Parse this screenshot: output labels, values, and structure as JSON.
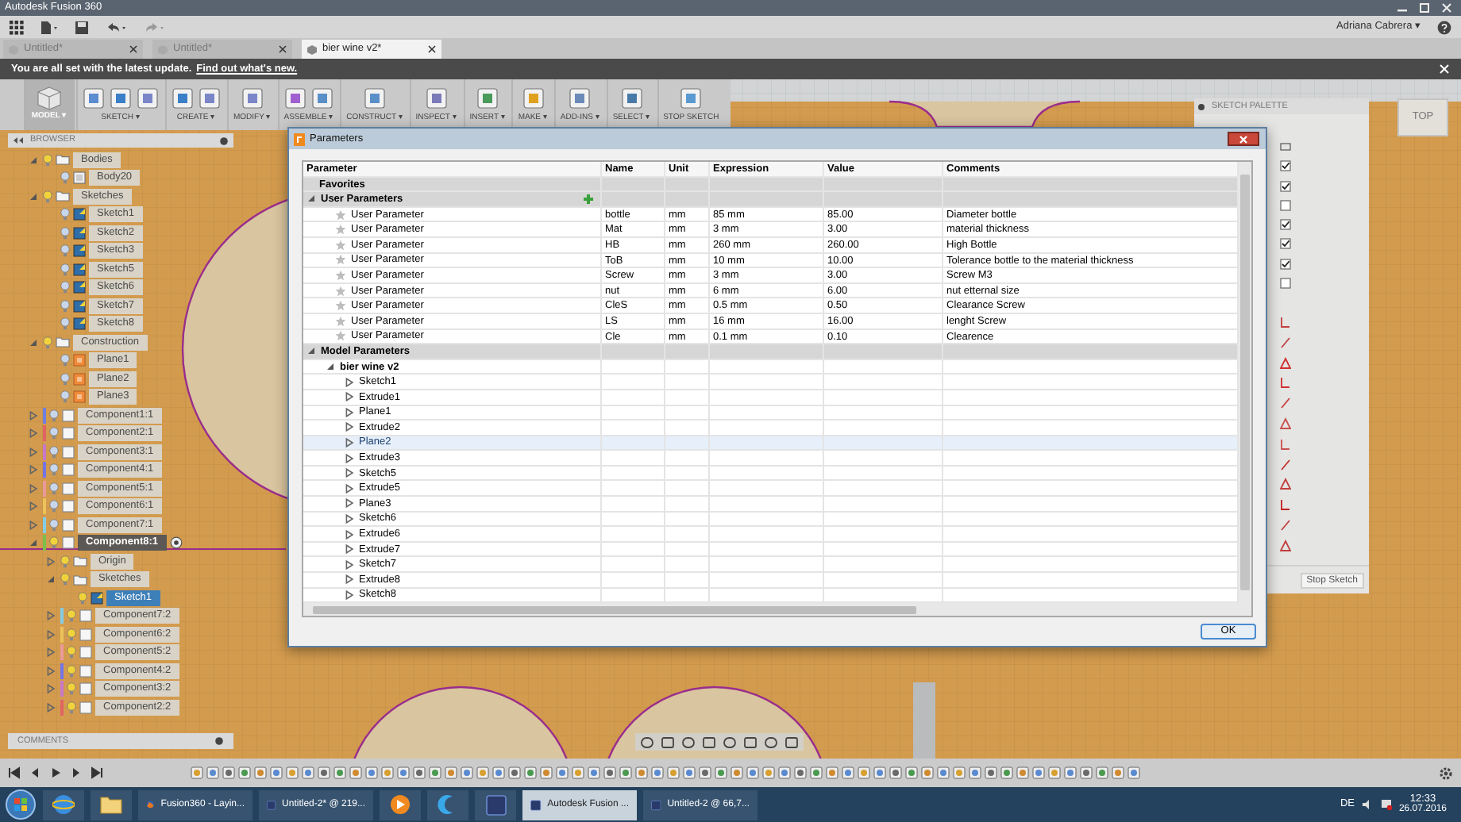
{
  "title_bar": {
    "title": "Autodesk Fusion 360"
  },
  "app_bar": {
    "user": "Adriana Cabrera ▾"
  },
  "tabs": [
    {
      "label": "Untitled*",
      "selected": false
    },
    {
      "label": "Untitled*",
      "selected": false
    },
    {
      "label": "bier wine v2*",
      "selected": true
    }
  ],
  "notice": {
    "text": "You are all set with the latest update.",
    "link": "Find out what's new."
  },
  "toolbar": {
    "workspace": {
      "label": "MODEL ▾"
    },
    "groups": [
      {
        "label": "SKETCH ▾"
      },
      {
        "label": "CREATE ▾"
      },
      {
        "label": "MODIFY ▾"
      },
      {
        "label": "ASSEMBLE ▾"
      },
      {
        "label": "CONSTRUCT ▾"
      },
      {
        "label": "INSPECT ▾"
      },
      {
        "label": "INSERT ▾"
      },
      {
        "label": "MAKE ▾"
      },
      {
        "label": "ADD-INS ▾"
      },
      {
        "label": "SELECT ▾"
      },
      {
        "label": "STOP SKETCH"
      }
    ]
  },
  "browser": {
    "title": "BROWSER",
    "items": [
      {
        "label": "Bodies",
        "kind": "folder",
        "expanded": true,
        "selected": false,
        "children": [
          {
            "label": "Body20",
            "kind": "body",
            "selected": false
          }
        ]
      },
      {
        "label": "Sketches",
        "kind": "folder",
        "expanded": true,
        "selected": false,
        "children": [
          {
            "label": "Sketch1",
            "kind": "sketch",
            "selected": false
          },
          {
            "label": "Sketch2",
            "kind": "sketch",
            "selected": false
          },
          {
            "label": "Sketch3",
            "kind": "sketch",
            "selected": false
          },
          {
            "label": "Sketch5",
            "kind": "sketch",
            "selected": false
          },
          {
            "label": "Sketch6",
            "kind": "sketch",
            "selected": false
          },
          {
            "label": "Sketch7",
            "kind": "sketch",
            "selected": false
          },
          {
            "label": "Sketch8",
            "kind": "sketch",
            "selected": false
          }
        ]
      },
      {
        "label": "Construction",
        "kind": "folder",
        "expanded": true,
        "selected": false,
        "children": [
          {
            "label": "Plane1",
            "kind": "plane",
            "selected": false
          },
          {
            "label": "Plane2",
            "kind": "plane",
            "selected": false
          },
          {
            "label": "Plane3",
            "kind": "plane",
            "selected": false
          }
        ]
      },
      {
        "label": "Component1:1",
        "kind": "component",
        "expanded": false,
        "selected": false,
        "color": "#6f7fe0"
      },
      {
        "label": "Component2:1",
        "kind": "component",
        "expanded": false,
        "selected": false,
        "color": "#e06464"
      },
      {
        "label": "Component3:1",
        "kind": "component",
        "expanded": false,
        "selected": false,
        "color": "#c878c8"
      },
      {
        "label": "Component4:1",
        "kind": "component",
        "expanded": false,
        "selected": false,
        "color": "#7474e4"
      },
      {
        "label": "Component5:1",
        "kind": "component",
        "expanded": false,
        "selected": false,
        "color": "#eb9a9a"
      },
      {
        "label": "Component6:1",
        "kind": "component",
        "expanded": false,
        "selected": false,
        "color": "#ecc25a"
      },
      {
        "label": "Component7:1",
        "kind": "component",
        "expanded": false,
        "selected": false,
        "color": "#84cce4"
      },
      {
        "label": "Component8:1",
        "kind": "component",
        "expanded": true,
        "selected": true,
        "color": "#7cc04a",
        "children": [
          {
            "label": "Origin",
            "kind": "folder",
            "expanded": false,
            "selected": false
          },
          {
            "label": "Sketches",
            "kind": "folder",
            "expanded": true,
            "selected": false,
            "children": [
              {
                "label": "Sketch1",
                "kind": "sketch",
                "selected": true
              }
            ]
          },
          {
            "label": "Component7:2",
            "kind": "component",
            "expanded": false,
            "selected": false,
            "color": "#84cce4"
          },
          {
            "label": "Component6:2",
            "kind": "component",
            "expanded": false,
            "selected": false,
            "color": "#ecc25a"
          },
          {
            "label": "Component5:2",
            "kind": "component",
            "expanded": false,
            "selected": false,
            "color": "#eb9a9a"
          },
          {
            "label": "Component4:2",
            "kind": "component",
            "expanded": false,
            "selected": false,
            "color": "#7474e4"
          },
          {
            "label": "Component3:2",
            "kind": "component",
            "expanded": false,
            "selected": false,
            "color": "#c878c8"
          },
          {
            "label": "Component2:2",
            "kind": "component",
            "expanded": false,
            "selected": false,
            "color": "#e06464"
          }
        ]
      }
    ]
  },
  "comments": {
    "title": "COMMENTS"
  },
  "view_cube": {
    "label": "TOP"
  },
  "sketch_palette": {
    "title": "SKETCH PALETTE",
    "options": [
      {
        "checked": true
      },
      {
        "checked": true
      },
      {
        "checked": false
      },
      {
        "checked": true
      },
      {
        "checked": true
      },
      {
        "checked": true
      },
      {
        "checked": false
      }
    ],
    "button": "Stop Sketch"
  },
  "parameters_dialog": {
    "title": "Parameters",
    "columns": [
      "Parameter",
      "Name",
      "Unit",
      "Expression",
      "Value",
      "Comments"
    ],
    "favorites": {
      "label": "Favorites"
    },
    "user_parameters": {
      "label": "User Parameters",
      "expanded": true,
      "rows": [
        {
          "label": "User Parameter",
          "favorite": false,
          "name": "bottle",
          "unit": "mm",
          "expression": "85 mm",
          "value": "85.00",
          "comment": "Diameter bottle"
        },
        {
          "label": "User Parameter",
          "favorite": false,
          "name": "Mat",
          "unit": "mm",
          "expression": "3 mm",
          "value": "3.00",
          "comment": "material thickness"
        },
        {
          "label": "User Parameter",
          "favorite": false,
          "name": "HB",
          "unit": "mm",
          "expression": "260 mm",
          "value": "260.00",
          "comment": "High Bottle"
        },
        {
          "label": "User Parameter",
          "favorite": false,
          "name": "ToB",
          "unit": "mm",
          "expression": "10 mm",
          "value": "10.00",
          "comment": "Tolerance bottle to the material thickness"
        },
        {
          "label": "User Parameter",
          "favorite": false,
          "name": "Screw",
          "unit": "mm",
          "expression": "3 mm",
          "value": "3.00",
          "comment": "Screw M3"
        },
        {
          "label": "User Parameter",
          "favorite": false,
          "name": "nut",
          "unit": "mm",
          "expression": "6 mm",
          "value": "6.00",
          "comment": "nut etternal size"
        },
        {
          "label": "User Parameter",
          "favorite": false,
          "name": "CleS",
          "unit": "mm",
          "expression": "0.5 mm",
          "value": "0.50",
          "comment": "Clearance Screw"
        },
        {
          "label": "User Parameter",
          "favorite": false,
          "name": "LS",
          "unit": "mm",
          "expression": "16 mm",
          "value": "16.00",
          "comment": "lenght Screw"
        },
        {
          "label": "User Parameter",
          "favorite": false,
          "name": "Cle",
          "unit": "mm",
          "expression": "0.1 mm",
          "value": "0.10",
          "comment": "Clearence"
        }
      ]
    },
    "model_parameters": {
      "label": "Model Parameters",
      "expanded": true,
      "children": [
        {
          "label": "bier wine v2",
          "expanded": true,
          "children": [
            {
              "label": "Sketch1",
              "expanded": false,
              "selected": false
            },
            {
              "label": "Extrude1",
              "expanded": false,
              "selected": false
            },
            {
              "label": "Plane1",
              "expanded": false,
              "selected": false
            },
            {
              "label": "Extrude2",
              "expanded": false,
              "selected": false
            },
            {
              "label": "Plane2",
              "expanded": false,
              "selected": true
            },
            {
              "label": "Extrude3",
              "expanded": false,
              "selected": false
            },
            {
              "label": "Sketch5",
              "expanded": false,
              "selected": false
            },
            {
              "label": "Extrude5",
              "expanded": false,
              "selected": false
            },
            {
              "label": "Plane3",
              "expanded": false,
              "selected": false
            },
            {
              "label": "Sketch6",
              "expanded": false,
              "selected": false
            },
            {
              "label": "Extrude6",
              "expanded": false,
              "selected": false
            },
            {
              "label": "Extrude7",
              "expanded": false,
              "selected": false
            },
            {
              "label": "Sketch7",
              "expanded": false,
              "selected": false
            },
            {
              "label": "Extrude8",
              "expanded": false,
              "selected": false
            },
            {
              "label": "Sketch8",
              "expanded": false,
              "selected": false
            }
          ]
        }
      ]
    },
    "ok": "OK"
  },
  "taskbar": {
    "apps": [
      {
        "kind": "globe",
        "selected": false
      },
      {
        "kind": "folder",
        "selected": false
      },
      {
        "kind": "fox",
        "label": "Fusion360 - Layin...",
        "selected": false
      },
      {
        "kind": "square",
        "label": "Untitled-2* @ 219...",
        "selected": false
      },
      {
        "kind": "play",
        "selected": false
      },
      {
        "kind": "crescent",
        "selected": false
      },
      {
        "kind": "square",
        "selected": false
      },
      {
        "kind": "square",
        "label": "Autodesk Fusion ...",
        "selected": true
      },
      {
        "kind": "square",
        "label": "Untitled-2 @ 66,7...",
        "selected": false
      }
    ],
    "language": "DE",
    "time": "12:33",
    "date": "26.07.2016"
  }
}
